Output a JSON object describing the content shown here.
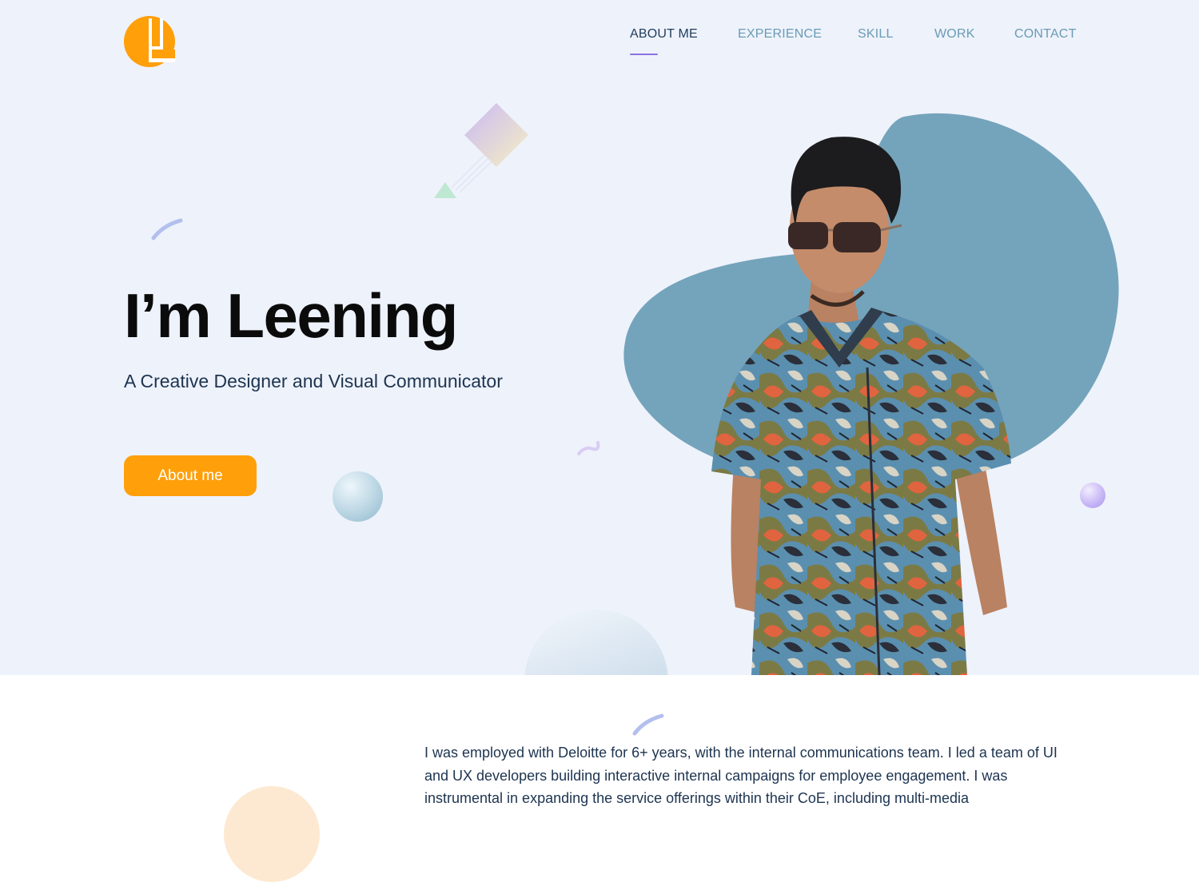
{
  "brand": {
    "logo_icon": "letter-l-logo-icon",
    "accent_color": "#ff9f0a",
    "nav_accent_color": "#8a74e0",
    "blob_color": "#74a4bb"
  },
  "nav": {
    "items": [
      {
        "label": "ABOUT ME",
        "active": true
      },
      {
        "label": "EXPERIENCE",
        "active": false
      },
      {
        "label": "SKILL",
        "active": false
      },
      {
        "label": "WORK",
        "active": false
      },
      {
        "label": "CONTACT",
        "active": false
      }
    ]
  },
  "hero": {
    "title": "I’m Leening",
    "subtitle": "A Creative Designer and Visual Communicator",
    "cta_label": "About me",
    "portrait_icon": "portrait-photo-icon"
  },
  "about": {
    "text": "I was employed with Deloitte for 6+ years, with the internal communications team. I led a team of UI and UX developers building interactive internal campaigns for employee engagement. I was instrumental in expanding the service offerings within their CoE, including multi-media"
  }
}
